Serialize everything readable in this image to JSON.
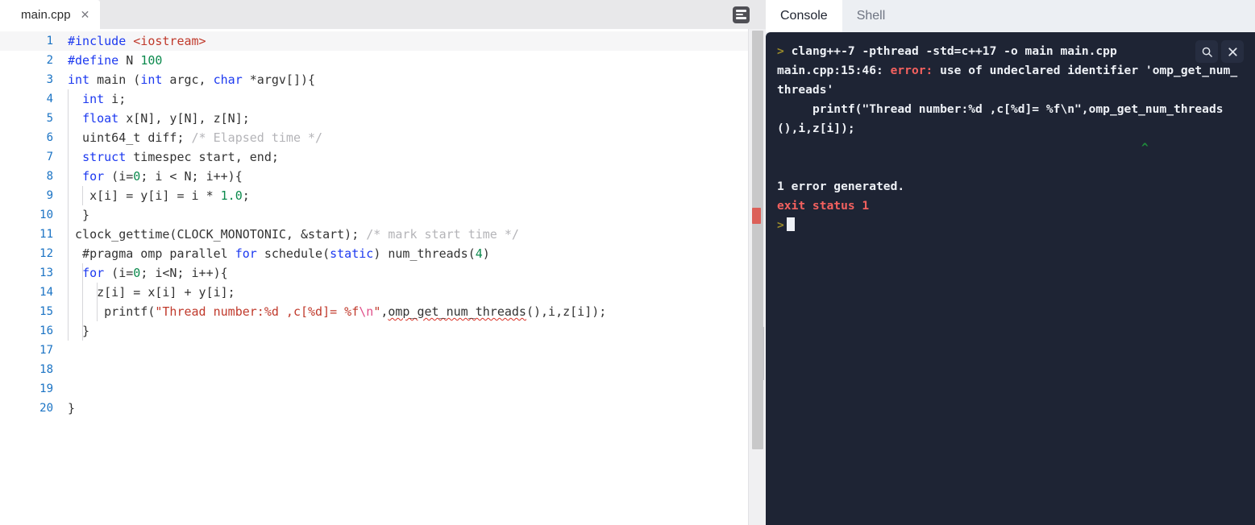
{
  "editor": {
    "tab": {
      "label": "main.cpp",
      "close_icon": "close-icon"
    },
    "format_icon": "format-document-icon",
    "lines": [
      {
        "n": "1",
        "active": true,
        "indent": 0,
        "tokens": [
          {
            "t": "#include ",
            "c": "pp"
          },
          {
            "t": "<iostream>",
            "c": "str"
          }
        ]
      },
      {
        "n": "2",
        "active": false,
        "indent": 0,
        "tokens": [
          {
            "t": "#define ",
            "c": "pp"
          },
          {
            "t": "N ",
            "c": "plain"
          },
          {
            "t": "100",
            "c": "num"
          }
        ]
      },
      {
        "n": "3",
        "active": false,
        "indent": 0,
        "tokens": [
          {
            "t": "int",
            "c": "kw"
          },
          {
            "t": " main (",
            "c": "plain"
          },
          {
            "t": "int",
            "c": "kw"
          },
          {
            "t": " argc, ",
            "c": "plain"
          },
          {
            "t": "char",
            "c": "kw"
          },
          {
            "t": " *argv[]){",
            "c": "plain"
          }
        ]
      },
      {
        "n": "4",
        "active": false,
        "indent": 1,
        "tokens": [
          {
            "t": "  ",
            "c": "plain"
          },
          {
            "t": "int",
            "c": "kw"
          },
          {
            "t": " i;",
            "c": "plain"
          }
        ]
      },
      {
        "n": "5",
        "active": false,
        "indent": 1,
        "tokens": [
          {
            "t": "  ",
            "c": "plain"
          },
          {
            "t": "float",
            "c": "kw"
          },
          {
            "t": " x[N], y[N], z[N];",
            "c": "plain"
          }
        ]
      },
      {
        "n": "6",
        "active": false,
        "indent": 1,
        "tokens": [
          {
            "t": "  uint64_t diff; ",
            "c": "plain"
          },
          {
            "t": "/* Elapsed time */",
            "c": "cmt"
          }
        ]
      },
      {
        "n": "7",
        "active": false,
        "indent": 1,
        "tokens": [
          {
            "t": "  ",
            "c": "plain"
          },
          {
            "t": "struct",
            "c": "kw"
          },
          {
            "t": " timespec start, end;",
            "c": "plain"
          }
        ]
      },
      {
        "n": "8",
        "active": false,
        "indent": 1,
        "tokens": [
          {
            "t": "  ",
            "c": "plain"
          },
          {
            "t": "for",
            "c": "kw"
          },
          {
            "t": " (i=",
            "c": "plain"
          },
          {
            "t": "0",
            "c": "num"
          },
          {
            "t": "; i < N; i++){",
            "c": "plain"
          }
        ]
      },
      {
        "n": "9",
        "active": false,
        "indent": 2,
        "tokens": [
          {
            "t": "   x[i] = y[i] = i * ",
            "c": "plain"
          },
          {
            "t": "1.0",
            "c": "num"
          },
          {
            "t": ";",
            "c": "plain"
          }
        ]
      },
      {
        "n": "10",
        "active": false,
        "indent": 1,
        "tokens": [
          {
            "t": "  }",
            "c": "plain"
          }
        ]
      },
      {
        "n": "11",
        "active": false,
        "indent": 1,
        "tokens": [
          {
            "t": " clock_gettime(CLOCK_MONOTONIC, &start); ",
            "c": "plain"
          },
          {
            "t": "/* mark start time */",
            "c": "cmt"
          }
        ]
      },
      {
        "n": "12",
        "active": false,
        "indent": 1,
        "tokens": [
          {
            "t": "  #pragma omp parallel ",
            "c": "plain"
          },
          {
            "t": "for",
            "c": "kw"
          },
          {
            "t": " schedule(",
            "c": "plain"
          },
          {
            "t": "static",
            "c": "kw"
          },
          {
            "t": ") num_threads(",
            "c": "plain"
          },
          {
            "t": "4",
            "c": "num"
          },
          {
            "t": ")",
            "c": "plain"
          }
        ]
      },
      {
        "n": "13",
        "active": false,
        "indent": 2,
        "tokens": [
          {
            "t": "  ",
            "c": "plain"
          },
          {
            "t": "for",
            "c": "kw"
          },
          {
            "t": " (i=",
            "c": "plain"
          },
          {
            "t": "0",
            "c": "num"
          },
          {
            "t": "; i<N; i++){",
            "c": "plain"
          }
        ]
      },
      {
        "n": "14",
        "active": false,
        "indent": 3,
        "tokens": [
          {
            "t": "    z[i] = x[i] + y[i];",
            "c": "plain"
          }
        ]
      },
      {
        "n": "15",
        "active": false,
        "indent": 3,
        "tokens": [
          {
            "t": "     printf(",
            "c": "plain"
          },
          {
            "t": "\"Thread number:%d ,c[%d]= %f",
            "c": "str"
          },
          {
            "t": "\\n",
            "c": "esc"
          },
          {
            "t": "\"",
            "c": "str"
          },
          {
            "t": ",",
            "c": "plain"
          },
          {
            "t": "omp_get_num_threads",
            "c": "plain squiggle"
          },
          {
            "t": "(),i,z[i]);",
            "c": "plain"
          }
        ]
      },
      {
        "n": "16",
        "active": false,
        "indent": 2,
        "tokens": [
          {
            "t": "  }",
            "c": "plain"
          }
        ]
      },
      {
        "n": "17",
        "active": false,
        "indent": 0,
        "tokens": []
      },
      {
        "n": "18",
        "active": false,
        "indent": 0,
        "tokens": []
      },
      {
        "n": "19",
        "active": false,
        "indent": 0,
        "tokens": []
      },
      {
        "n": "20",
        "active": false,
        "indent": 0,
        "tokens": [
          {
            "t": "}",
            "c": "plain"
          }
        ]
      }
    ],
    "scrollbar": {
      "name": "editor-vertical-scrollbar",
      "error_marker": "error-marker"
    }
  },
  "console": {
    "tabs": [
      {
        "label": "Console",
        "active": true
      },
      {
        "label": "Shell",
        "active": false
      }
    ],
    "search_icon": "search-icon",
    "close_icon": "close-icon",
    "output": [
      {
        "kind": "command",
        "prompt": ">",
        "text": " clang++-7 -pthread -std=c++17 -o main main.cpp"
      },
      {
        "kind": "error_head",
        "prefix": "main.cpp:15:46: ",
        "error_word": "error: ",
        "text": "use of undeclared identifier 'omp_get_num_threads'"
      },
      {
        "kind": "snippet",
        "text": "     printf(\"Thread number:%d ,c[%d]= %f\\n\",omp_get_num_threads(),i,z[i]);"
      },
      {
        "kind": "caret",
        "text": "^"
      },
      {
        "kind": "blank",
        "text": ""
      },
      {
        "kind": "plain",
        "text": "1 error generated."
      },
      {
        "kind": "exit",
        "text": "exit status 1"
      },
      {
        "kind": "prompt_cursor",
        "prompt": ">",
        "text": ""
      }
    ]
  },
  "colors": {
    "console_bg": "#1e2434",
    "error_red": "#f4615f",
    "prompt_olive": "#9a8a2a",
    "caret_green": "#1f8a3b",
    "keyword_blue": "#1c39f0",
    "string_red": "#c0392b",
    "number_green": "#0c8a4d",
    "comment_gray": "#b4b4b8",
    "lineno_blue": "#1a73c4"
  }
}
